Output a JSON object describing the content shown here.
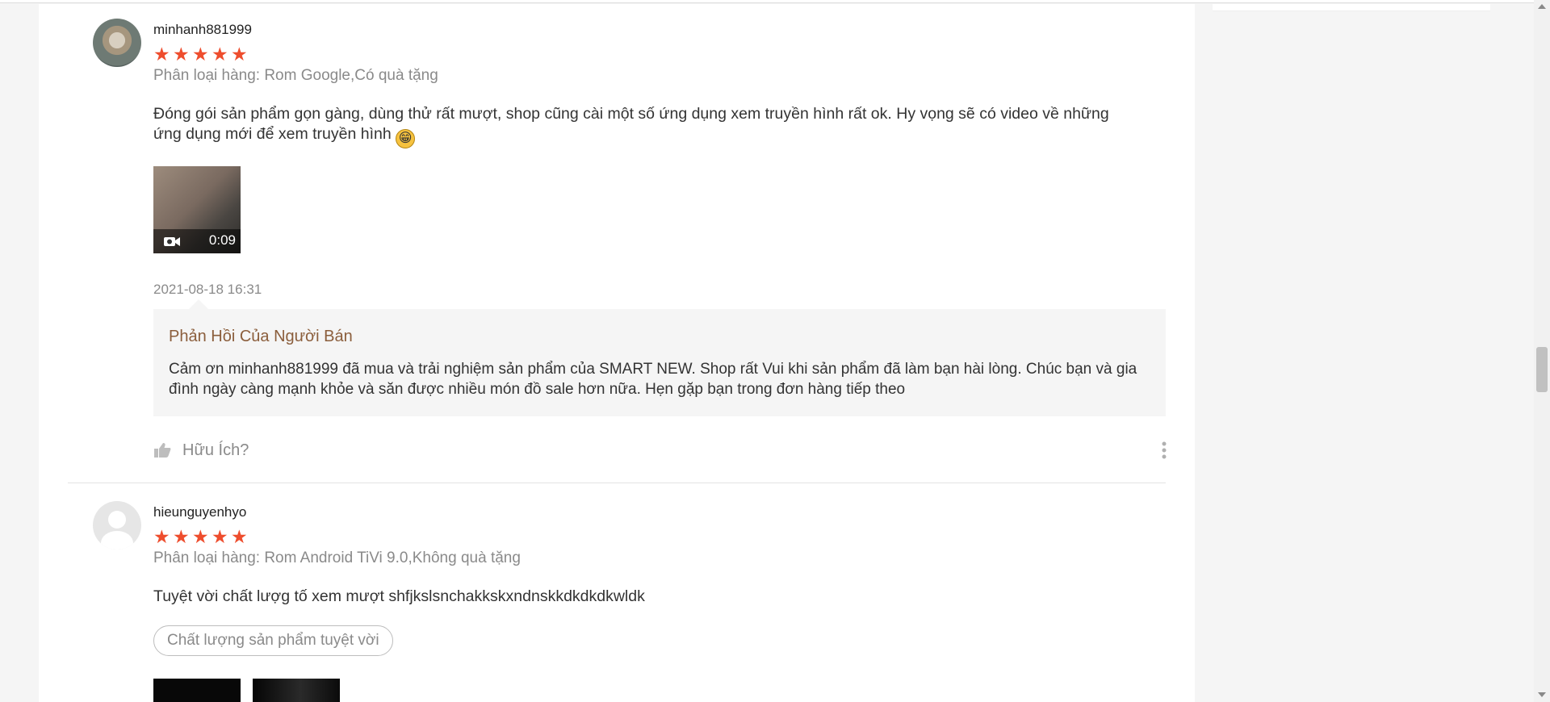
{
  "colors": {
    "accent_star": "#ee4d2d",
    "seller_reply_title": "#8b5e3c",
    "muted_text": "#8a8a8a",
    "reply_background": "#f5f5f5"
  },
  "reviews": [
    {
      "username": "minhanh881999",
      "rating": 5,
      "variant": "Phân loại hàng: Rom Google,Có quà tặng",
      "comment": "Đóng gói sản phẩm gọn gàng, dùng thử rất mượt, shop cũng cài một số ứng dụng xem truyền hình rất ok. Hy vọng sẽ có video về những ứng dụng mới để xem truyền hình",
      "video_duration": "0:09",
      "time": "2021-08-18 16:31",
      "seller_reply": {
        "title": "Phản Hồi Của Người Bán",
        "text": "Cảm ơn minhanh881999 đã mua và trải nghiệm sản phẩm của SMART NEW. Shop rất Vui khi sản phẩm đã làm bạn hài lòng. Chúc bạn và gia đình ngày càng mạnh khỏe và săn được nhiều món đồ sale hơn nữa. Hẹn gặp bạn trong đơn hàng tiếp theo"
      },
      "helpful_label": "Hữu Ích?"
    },
    {
      "username": "hieunguyenhyo",
      "rating": 5,
      "variant": "Phân loại hàng: Rom Android TiVi 9.0,Không quà tặng",
      "comment": "Tuyệt vời chất lượg tố xem mượt shfjkslsnchakkskxndnskkdkdkdkwldk",
      "tag": "Chất lượng sản phẩm tuyệt vời"
    }
  ],
  "icons": {
    "star": "star-icon",
    "video": "video-camera-icon",
    "helpful": "thumb-up-icon",
    "more": "more-vertical-icon"
  }
}
